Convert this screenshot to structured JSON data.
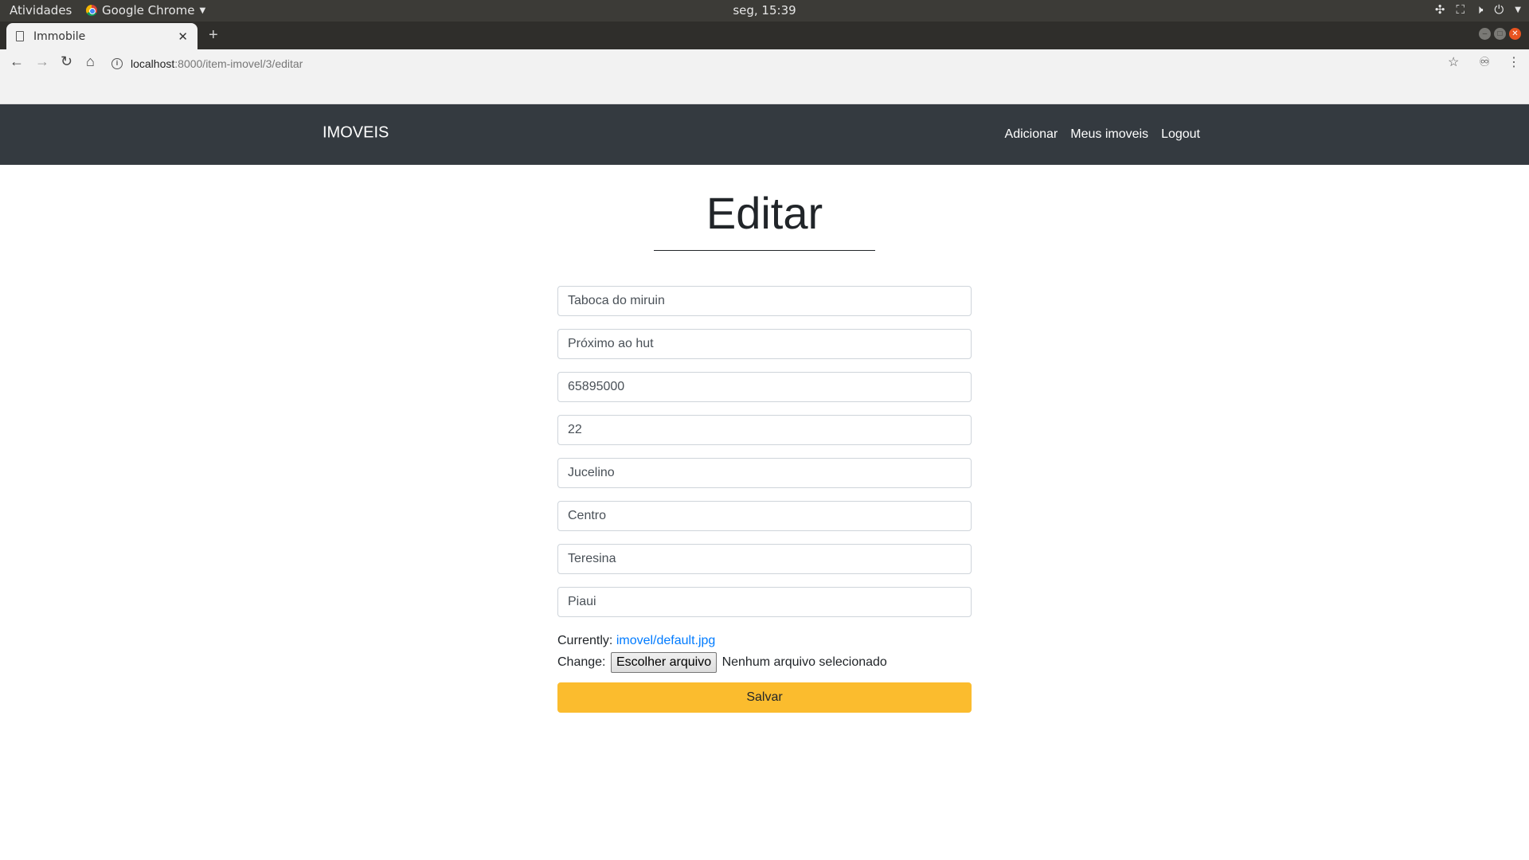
{
  "os": {
    "activities": "Atividades",
    "app_name": "Google Chrome",
    "clock": "seg, 15:39"
  },
  "browser": {
    "tab_title": "Immobile",
    "url_host": "localhost",
    "url_path": ":8000/item-imovel/3/editar"
  },
  "navbar": {
    "brand": "IMOVEIS",
    "links": [
      "Adicionar",
      "Meus imoveis",
      "Logout"
    ]
  },
  "page": {
    "title": "Editar"
  },
  "form": {
    "fields": [
      "Taboca do miruin",
      "Próximo ao hut",
      "65895000",
      "22",
      "Jucelino",
      "Centro",
      "Teresina",
      "Piaui"
    ],
    "currently_label": "Currently:",
    "current_file": "imovel/default.jpg",
    "change_label": "Change:",
    "choose_file_button": "Escolher arquivo",
    "no_file_text": "Nenhum arquivo selecionado",
    "submit_label": "Salvar"
  },
  "colors": {
    "navbar_bg": "#343a40",
    "submit_bg": "#fbbc2e",
    "link": "#007bff"
  }
}
